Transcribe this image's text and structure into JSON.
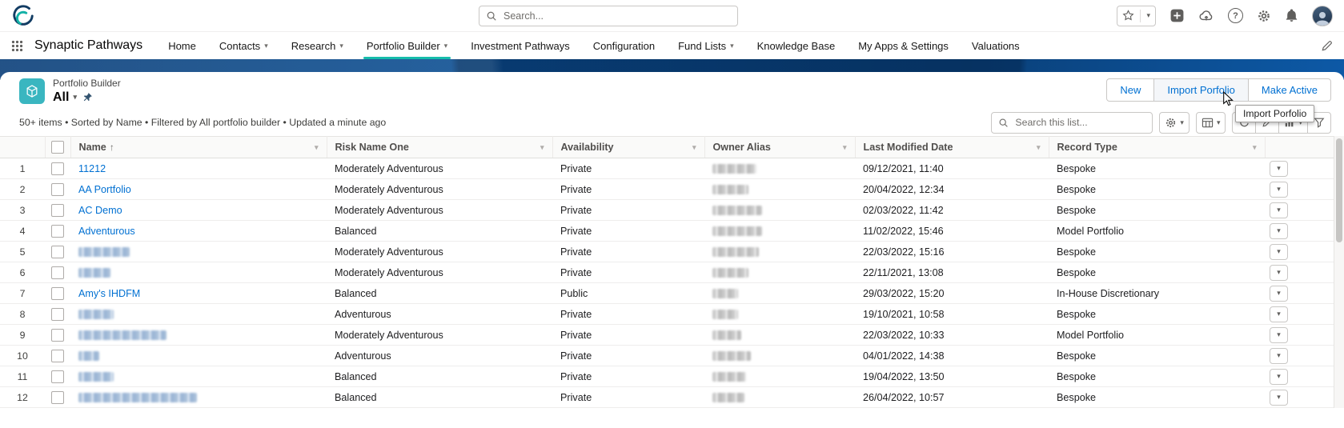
{
  "glyphs": {
    "caret": "▾",
    "sort_asc": "↑",
    "help": "?"
  },
  "colors": {
    "accent_teal": "#16bcab",
    "link_blue": "#0070d2",
    "band_navy": "#0c5095",
    "object_icon_teal": "#3ab6c0"
  },
  "global_header": {
    "search_placeholder": "Search...",
    "icons": [
      "favorites-star",
      "global-actions-add",
      "cloud-upload",
      "help",
      "setup-gear",
      "notifications-bell",
      "user-avatar"
    ]
  },
  "nav": {
    "app_name": "Synaptic Pathways",
    "launcher_icon": "app-launcher-waffle",
    "edit_icon": "pencil",
    "items": [
      {
        "label": "Home"
      },
      {
        "label": "Contacts",
        "caret": true
      },
      {
        "label": "Research",
        "caret": true
      },
      {
        "label": "Portfolio Builder",
        "caret": true,
        "active": true
      },
      {
        "label": "Investment Pathways"
      },
      {
        "label": "Configuration"
      },
      {
        "label": "Fund Lists",
        "caret": true
      },
      {
        "label": "Knowledge Base"
      },
      {
        "label": "My Apps & Settings"
      },
      {
        "label": "Valuations"
      }
    ]
  },
  "list_header": {
    "entity_label": "Portfolio Builder",
    "view_label": "All",
    "pin_icon": "pin",
    "action_buttons": [
      {
        "label": "New",
        "name": "new-button"
      },
      {
        "label": "Import Porfolio",
        "name": "import-portfolio-button",
        "hovered": true
      },
      {
        "label": "Make Active",
        "name": "make-active-button"
      }
    ],
    "tooltip": "Import Porfolio",
    "meta": "50+ items • Sorted by Name • Filtered by All portfolio builder • Updated a minute ago",
    "list_search_placeholder": "Search this list...",
    "control_icons": [
      "list-settings-gear",
      "display-as-table",
      "refresh",
      "inline-edit",
      "charts",
      "filters"
    ]
  },
  "table": {
    "columns": [
      {
        "label": "Name",
        "sorted": "asc"
      },
      {
        "label": "Risk Name One"
      },
      {
        "label": "Availability"
      },
      {
        "label": "Owner Alias"
      },
      {
        "label": "Last Modified Date"
      },
      {
        "label": "Record Type"
      }
    ],
    "rows": [
      {
        "num": "1",
        "name": "11212",
        "risk": "Moderately Adventurous",
        "availability": "Private",
        "owner_redacted_width": 55,
        "modified": "09/12/2021, 11:40",
        "record_type": "Bespoke"
      },
      {
        "num": "2",
        "name": "AA Portfolio",
        "risk": "Moderately Adventurous",
        "availability": "Private",
        "owner_redacted_width": 45,
        "modified": "20/04/2022, 12:34",
        "record_type": "Bespoke"
      },
      {
        "num": "3",
        "name": "AC Demo",
        "risk": "Moderately Adventurous",
        "availability": "Private",
        "owner_redacted_width": 62,
        "modified": "02/03/2022, 11:42",
        "record_type": "Bespoke"
      },
      {
        "num": "4",
        "name": "Adventurous",
        "risk": "Balanced",
        "availability": "Private",
        "owner_redacted_width": 62,
        "modified": "11/02/2022, 15:46",
        "record_type": "Model Portfolio"
      },
      {
        "num": "5",
        "name": null,
        "name_redacted_width": 64,
        "risk": "Moderately Adventurous",
        "availability": "Private",
        "owner_redacted_width": 58,
        "modified": "22/03/2022, 15:16",
        "record_type": "Bespoke"
      },
      {
        "num": "6",
        "name": null,
        "name_redacted_width": 40,
        "risk": "Moderately Adventurous",
        "availability": "Private",
        "owner_redacted_width": 45,
        "modified": "22/11/2021, 13:08",
        "record_type": "Bespoke"
      },
      {
        "num": "7",
        "name": "Amy's IHDFM",
        "risk": "Balanced",
        "availability": "Public",
        "owner_redacted_width": 32,
        "modified": "29/03/2022, 15:20",
        "record_type": "In-House Discretionary"
      },
      {
        "num": "8",
        "name": null,
        "name_redacted_width": 44,
        "risk": "Adventurous",
        "availability": "Private",
        "owner_redacted_width": 32,
        "modified": "19/10/2021, 10:58",
        "record_type": "Bespoke"
      },
      {
        "num": "9",
        "name": null,
        "name_redacted_width": 110,
        "risk": "Moderately Adventurous",
        "availability": "Private",
        "owner_redacted_width": 36,
        "modified": "22/03/2022, 10:33",
        "record_type": "Model Portfolio"
      },
      {
        "num": "10",
        "name": null,
        "name_redacted_width": 26,
        "risk": "Adventurous",
        "availability": "Private",
        "owner_redacted_width": 48,
        "modified": "04/01/2022, 14:38",
        "record_type": "Bespoke"
      },
      {
        "num": "11",
        "name": null,
        "name_redacted_width": 44,
        "risk": "Balanced",
        "availability": "Private",
        "owner_redacted_width": 42,
        "modified": "19/04/2022, 13:50",
        "record_type": "Bespoke"
      },
      {
        "num": "12",
        "name": null,
        "name_redacted_width": 148,
        "risk": "Balanced",
        "availability": "Private",
        "owner_redacted_width": 40,
        "modified": "26/04/2022, 10:57",
        "record_type": "Bespoke"
      }
    ]
  }
}
